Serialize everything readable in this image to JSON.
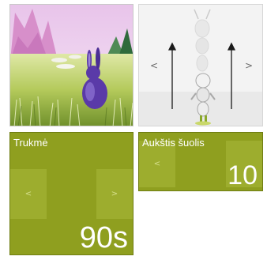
{
  "scene_tile": {
    "image": "rabbit-in-grass-scene"
  },
  "character_tile": {
    "prev_glyph": "<",
    "next_glyph": ">",
    "figure": "ant-character-jumping"
  },
  "duration_tile": {
    "label": "Trukmė",
    "value": "90s",
    "prev_glyph": "<",
    "next_glyph": ">"
  },
  "jump_tile": {
    "label": "Aukštis šuolis",
    "value": "10",
    "prev_glyph": "<",
    "next_glyph": ">"
  },
  "colors": {
    "tile_green": "#8f9f1f",
    "nav_green": "#9dad2e"
  }
}
